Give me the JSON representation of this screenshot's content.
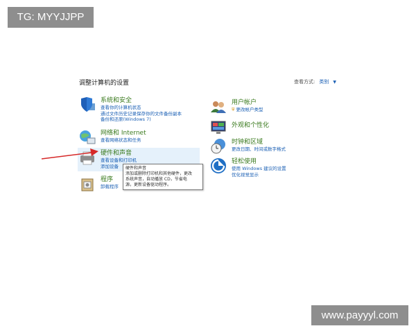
{
  "watermarks": {
    "top_left": "TG: MYYJJPP",
    "bottom_right": "www.payyyl.com"
  },
  "page_title": "调整计算机的设置",
  "view_by": {
    "label": "查看方式:",
    "value": "类别"
  },
  "categories_left": [
    {
      "title": "系统和安全",
      "icon": "shield-icon",
      "links": [
        "查看你的计算机状态",
        "通过文件历史记录保存你的文件备份副本",
        "备份和还原(Windows 7)"
      ]
    },
    {
      "title": "网络和 Internet",
      "icon": "network-globe-icon",
      "links": [
        "查看网络状态和任务"
      ]
    },
    {
      "title": "硬件和声音",
      "icon": "printer-icon",
      "links": [
        "查看设备和打印机",
        "添加设备"
      ]
    },
    {
      "title": "程序",
      "icon": "programs-box-icon",
      "links": [
        "卸载程序"
      ]
    }
  ],
  "categories_right": [
    {
      "title": "用户帐户",
      "icon": "users-icon",
      "links": [
        "更改帐户类型"
      ]
    },
    {
      "title": "外观和个性化",
      "icon": "display-icon",
      "links": []
    },
    {
      "title": "时钟和区域",
      "icon": "clock-globe-icon",
      "links": [
        "更改日期、时间或数字格式"
      ]
    },
    {
      "title": "轻松使用",
      "icon": "ease-of-access-icon",
      "links": [
        "使用 Windows 建议的设置",
        "优化视觉显示"
      ]
    }
  ],
  "tooltip": {
    "title": "硬件和声音",
    "lines": [
      "添加或删除打印机和其他硬件，更改",
      "系统声音，自动播放 CD，节省电",
      "源，更新设备驱动程序。"
    ]
  },
  "colors": {
    "category_title": "#3a7a1e",
    "link": "#1a5fb4",
    "arrow": "#d62828",
    "hover": "#e5f1fb"
  }
}
